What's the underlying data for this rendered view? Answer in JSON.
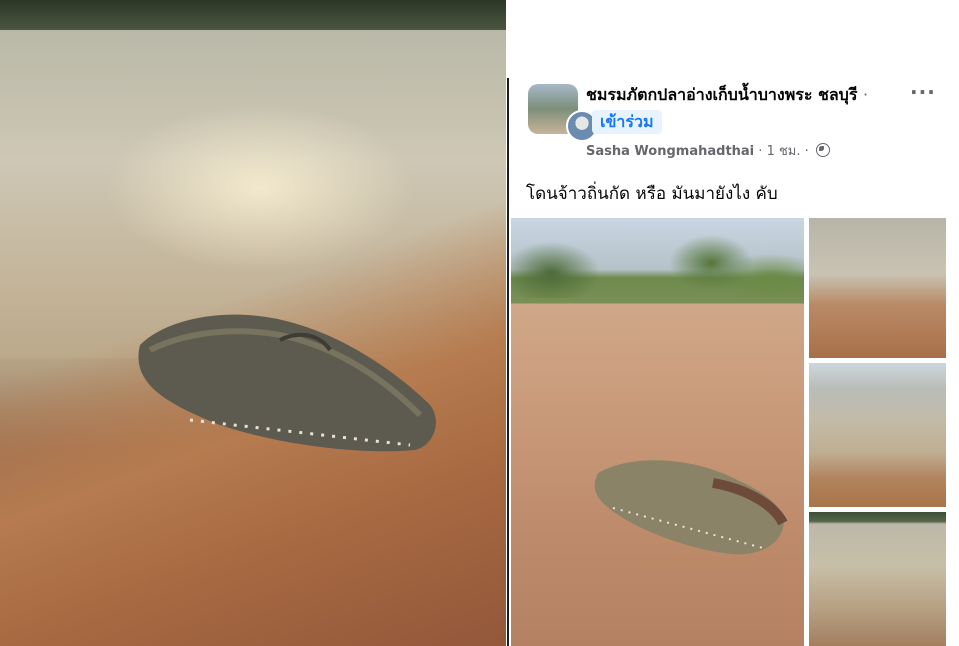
{
  "post": {
    "group_name": "ชมรมภัตกปลาอ่างเก็บน้ำบางพระ ชลบุรี",
    "separator": "·",
    "join_label": "เข้าร่วม",
    "more_label": "···",
    "author": "Sasha Wongmahadthai",
    "time": "1 ชม.",
    "meta_separator": "·",
    "privacy_icon": "globe-icon",
    "text": "โดนจ้าวถิ่นกัด หรือ มันมายังไง คับ"
  },
  "colors": {
    "join_button_bg": "#e7f3ff",
    "join_button_text": "#1877f2",
    "meta_text": "#65676b"
  }
}
